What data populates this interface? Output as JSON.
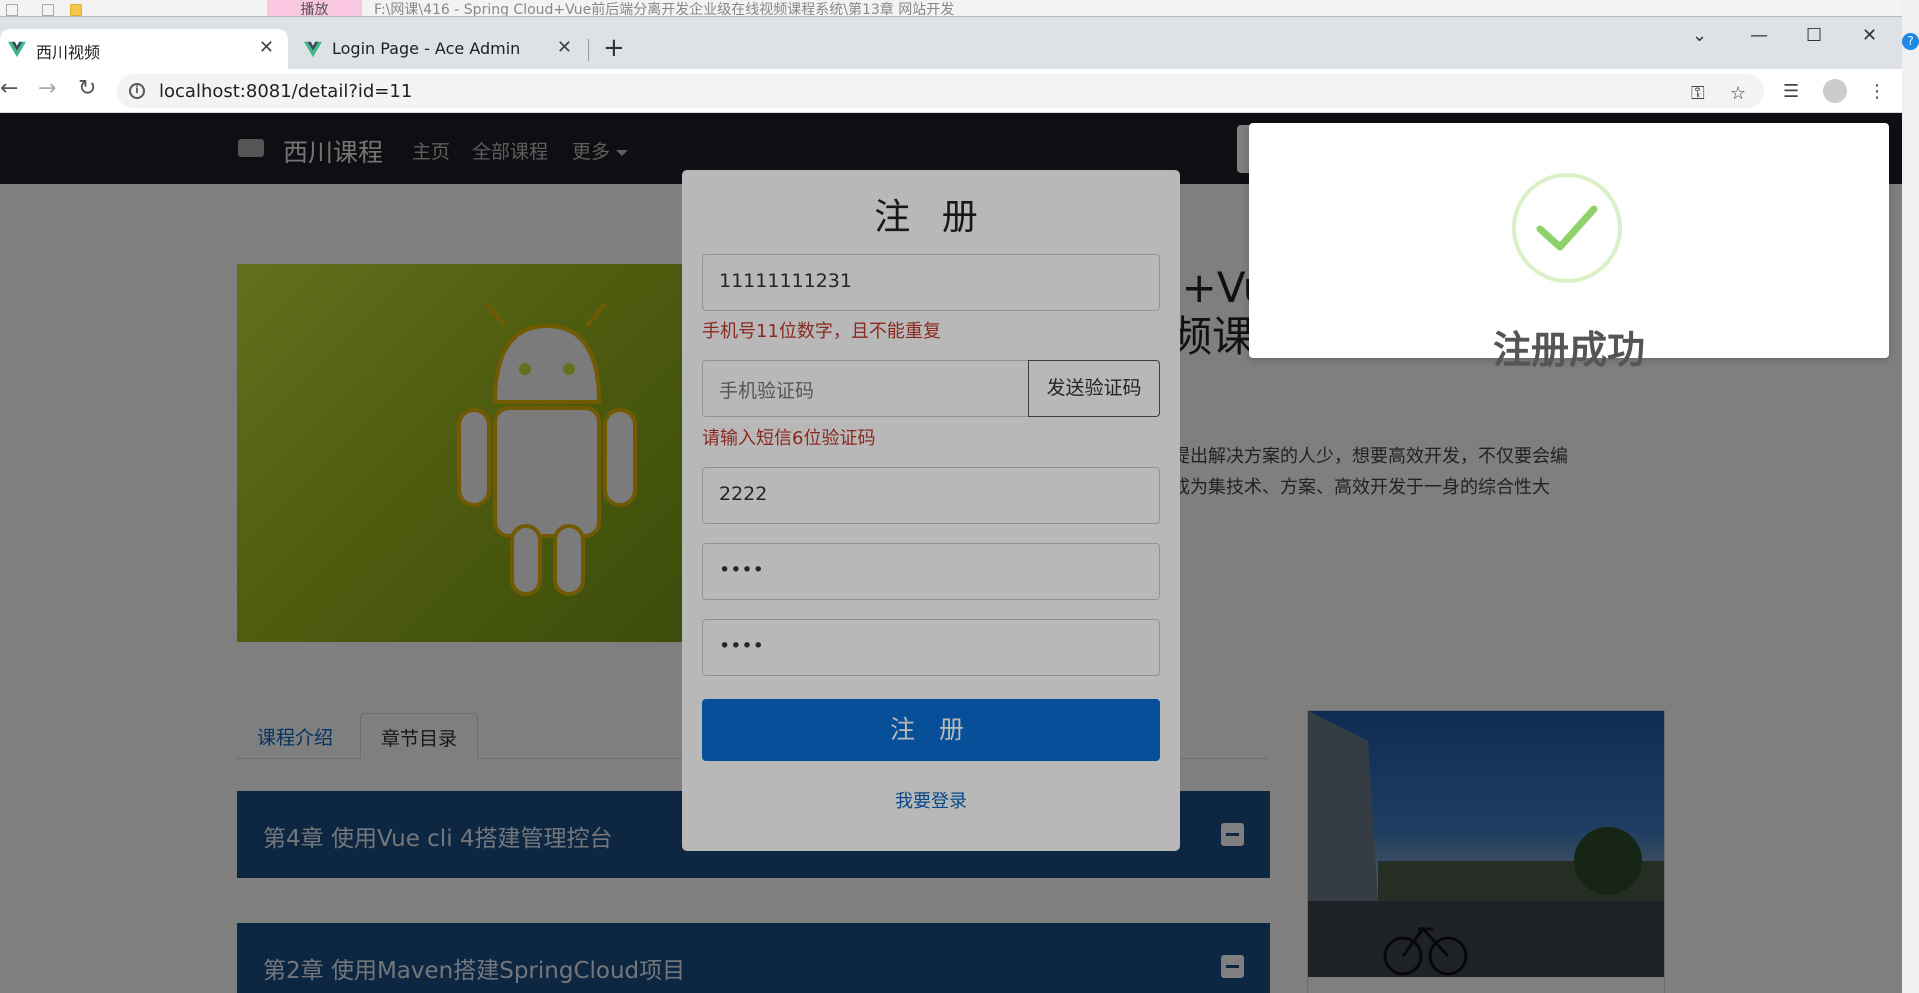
{
  "explorer": {
    "play_label": "播放",
    "path": "F:\\网课\\416 - Spring Cloud+Vue前后端分离开发企业级在线视频课程系统\\第13章 网站开发"
  },
  "browser": {
    "tabs": [
      {
        "title": "西川视频",
        "active": true
      },
      {
        "title": "Login Page - Ace Admin",
        "active": false
      }
    ],
    "url": "localhost:8081/detail?id=11",
    "new_tab_symbol": "+",
    "close_symbol": "✕"
  },
  "site": {
    "brand": "西川课程",
    "nav": [
      "主页",
      "全部课程",
      "更多"
    ],
    "course_title_fragment": "l+Vu",
    "course_title_fragment_2": "频课程",
    "description": "提出解决方案的人少，想要高效开发，不仅要会编\n成为集技术、方案、高效开发于一身的综合性大",
    "tabs": [
      "课程介绍",
      "章节目录"
    ],
    "chapters": [
      "第4章 使用Vue cli 4搭建管理控台",
      "第2章 使用Maven搭建SpringCloud项目"
    ]
  },
  "register_modal": {
    "title": "注 册",
    "mobile_value": "11111111231",
    "mobile_error": "手机号11位数字，且不能重复",
    "code_placeholder": "手机验证码",
    "send_code_label": "发送验证码",
    "code_error": "请输入短信6位验证码",
    "name_value": "2222",
    "password_value": "••••",
    "confirm_value": "••••",
    "submit_label": "注 册",
    "login_link": "我要登录"
  },
  "toast": {
    "message": "注册成功",
    "accent_color": "#8fd16b"
  },
  "colors": {
    "primary": "#0a6ed4",
    "error": "#c0392b",
    "chapter_bg": "#1a4c82",
    "nav_bg": "#1c1f24"
  }
}
